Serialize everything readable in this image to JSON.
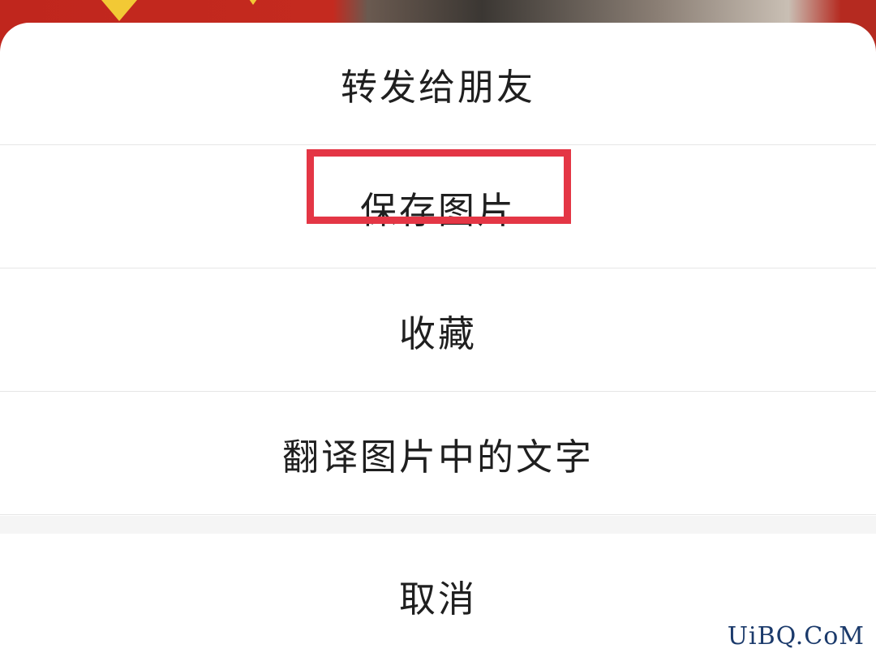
{
  "action_sheet": {
    "items": [
      {
        "label": "转发给朋友"
      },
      {
        "label": "保存图片"
      },
      {
        "label": "收藏"
      },
      {
        "label": "翻译图片中的文字"
      }
    ],
    "cancel_label": "取消"
  },
  "highlight": {
    "target": "保存图片",
    "color": "#e43645"
  },
  "watermark": "UiBQ.CoM"
}
